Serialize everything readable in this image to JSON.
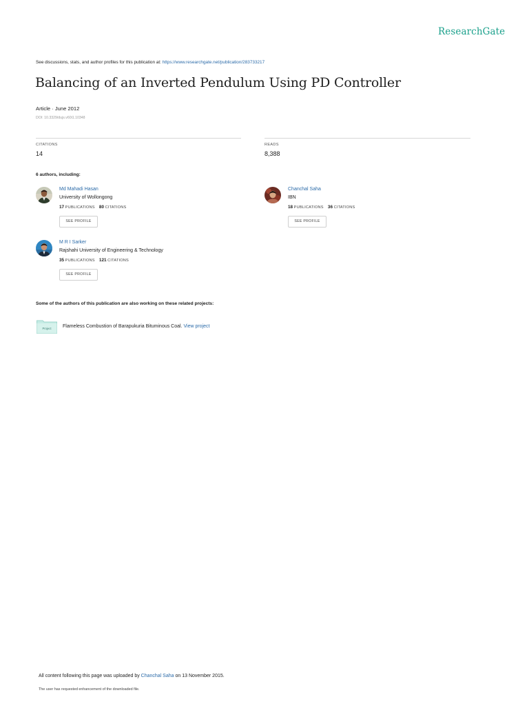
{
  "brand": {
    "logo": "ResearchGate",
    "color": "#1aa08b"
  },
  "discussion": {
    "lead": "See discussions, stats, and author profiles for this publication at: ",
    "url": "https://www.researchgate.net/publication/283733217"
  },
  "publication": {
    "title": "Balancing of an Inverted Pendulum Using PD Controller",
    "meta": "Article · June 2012",
    "doi": "DOI: 10.3329/dujs.v60i1.10348"
  },
  "stats": {
    "citations_label": "CITATIONS",
    "citations_value": "14",
    "reads_label": "READS",
    "reads_value": "8,388"
  },
  "authors_heading": "6 authors, including:",
  "authors": [
    {
      "name": "Md Mahadi Hasan",
      "institution": "University of Wollongong",
      "publications": "17",
      "pub_label": "PUBLICATIONS",
      "citations": "80",
      "cit_label": "CITATIONS",
      "button": "SEE PROFILE",
      "avatar": "avatar-photo-1"
    },
    {
      "name": "Chanchal Saha",
      "institution": "IBN",
      "publications": "18",
      "pub_label": "PUBLICATIONS",
      "citations": "36",
      "cit_label": "CITATIONS",
      "button": "SEE PROFILE",
      "avatar": "avatar-photo-2"
    },
    {
      "name": "M R I Sarker",
      "institution": "Rajshahi University of Engineering & Technology",
      "publications": "35",
      "pub_label": "PUBLICATIONS",
      "citations": "121",
      "cit_label": "CITATIONS",
      "button": "SEE PROFILE",
      "avatar": "avatar-photo-3"
    }
  ],
  "projects": {
    "heading": "Some of the authors of this publication are also working on these related projects:",
    "icon_label": "Project",
    "items": [
      {
        "text": "Flameless Combustion of Barapukuria Bituminous Coal. ",
        "link": "View project"
      }
    ]
  },
  "footer": {
    "uploaded_prefix": "All content following this page was uploaded by ",
    "uploader": "Chanchal Saha",
    "uploaded_suffix": " on 13 November 2015.",
    "note": "The user has requested enhancement of the downloaded file."
  }
}
